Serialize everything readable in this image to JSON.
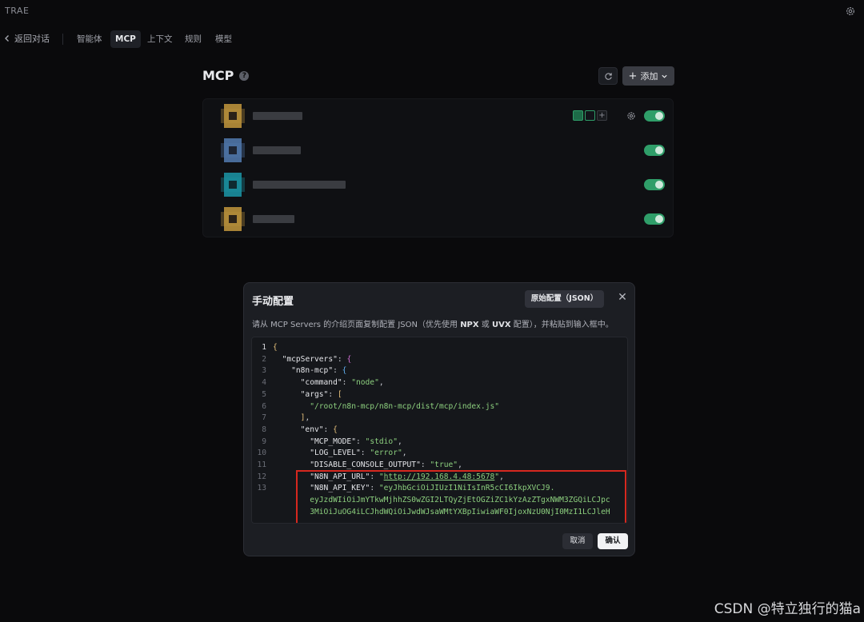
{
  "app": {
    "title": "TRAE"
  },
  "tabbar": {
    "back_label": "返回对话",
    "tabs": [
      {
        "label": "智能体",
        "active": false
      },
      {
        "label": "MCP",
        "active": true
      },
      {
        "label": "上下文",
        "active": false
      },
      {
        "label": "规则",
        "active": false
      },
      {
        "label": "模型",
        "active": false
      }
    ]
  },
  "mcp": {
    "title": "MCP",
    "add_label": "添加",
    "servers": [
      {
        "enabled": true,
        "icon_color": "#b9903b"
      },
      {
        "enabled": true,
        "icon_color": "#4f76a8"
      },
      {
        "enabled": true,
        "icon_color": "#1b8fa0"
      },
      {
        "enabled": true,
        "icon_color": "#b9903b"
      }
    ]
  },
  "dialog": {
    "title": "手动配置",
    "raw_button": "原始配置（JSON）",
    "description_pre": "请从 MCP Servers 的介绍页面复制配置 JSON（优先使用 ",
    "description_npx": "NPX",
    "description_mid": " 或 ",
    "description_uvx": "UVX",
    "description_post": " 配置），并粘贴到输入框中。",
    "cancel_label": "取消",
    "confirm_label": "确认",
    "code": {
      "line_numbers": [
        "1",
        "2",
        "3",
        "4",
        "5",
        "6",
        "7",
        "8",
        "9",
        "10",
        "11",
        "12",
        "13"
      ],
      "mcpServers_key": "\"mcpServers\"",
      "server_key": "\"n8n-mcp\"",
      "command_key": "\"command\"",
      "command_val": "\"node\"",
      "args_key": "\"args\"",
      "args_val": "\"/root/n8n-mcp/n8n-mcp/dist/mcp/index.js\"",
      "env_key": "\"env\"",
      "mode_key": "\"MCP_MODE\"",
      "mode_val": "\"stdio\"",
      "log_key": "\"LOG_LEVEL\"",
      "log_val": "\"error\"",
      "disable_key": "\"DISABLE_CONSOLE_OUTPUT\"",
      "disable_val": "\"true\"",
      "url_key": "\"N8N_API_URL\"",
      "url_val": "http://192.168.4.48:5678",
      "apikey_key": "\"N8N_API_KEY\"",
      "apikey_val_1": "\"eyJhbGciOiJIUzI1NiIsInR5cCI6IkpXVCJ9.",
      "apikey_val_2": "eyJzdWIiOiJmYTkwMjhhZS0wZGI2LTQyZjEtOGZiZC1kYzAzZTgxNWM3ZGQiLCJpc",
      "apikey_val_3": "3MiOiJuOG4iLCJhdWQiOiJwdWJsaWMtYXBpIiwiaWF0IjoxNzU0NjI0MzI1LCJleH"
    }
  },
  "watermark": "CSDN @特立独行的猫a"
}
